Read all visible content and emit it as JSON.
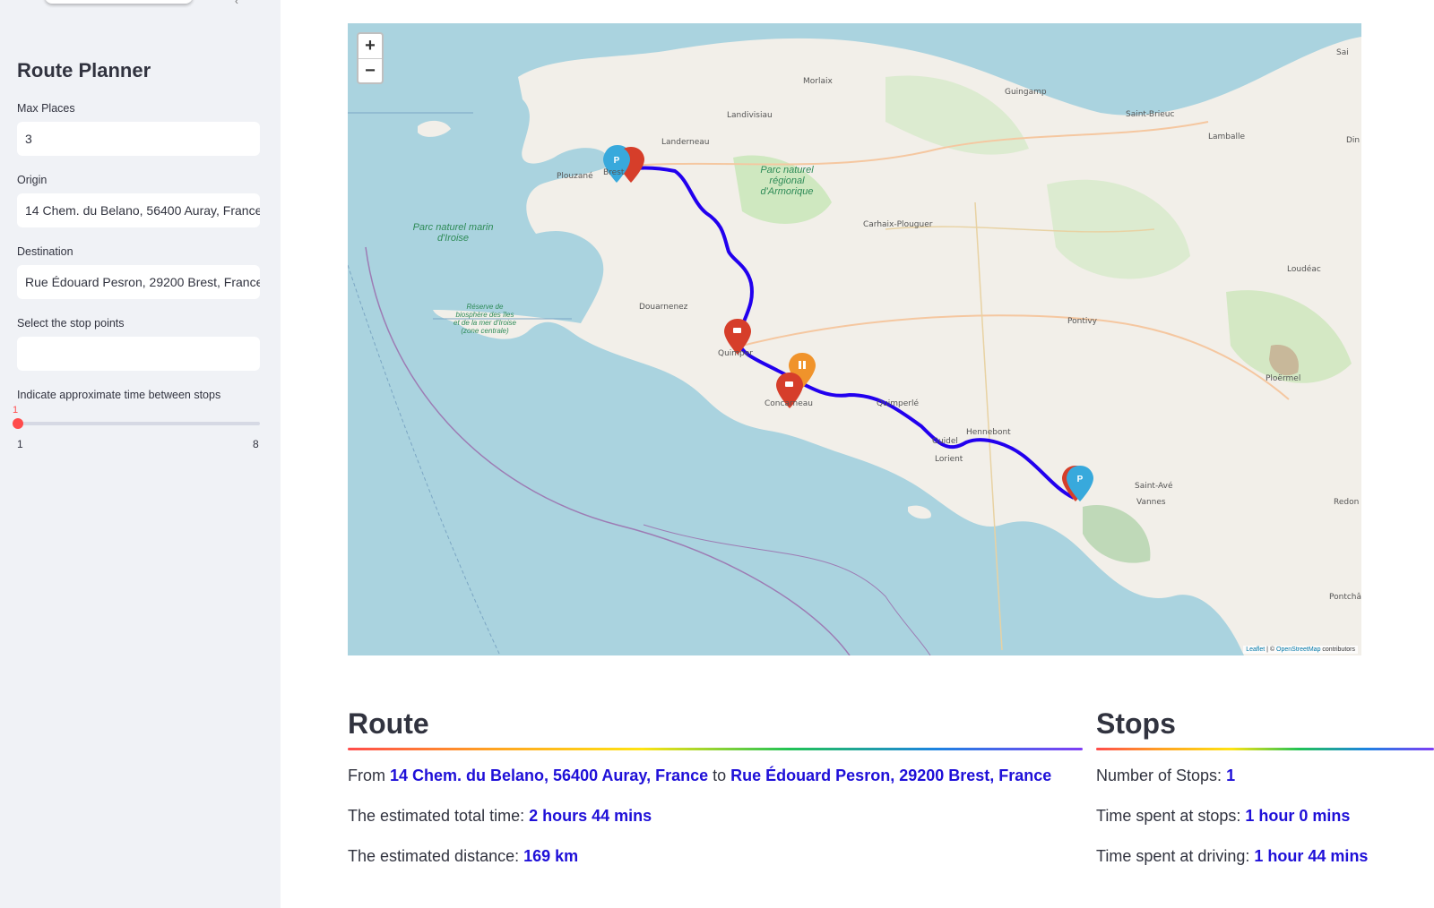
{
  "sidebar": {
    "title": "Route Planner",
    "max_places_label": "Max Places",
    "max_places_value": "3",
    "origin_label": "Origin",
    "origin_value": "14 Chem. du Belano, 56400 Auray, France",
    "destination_label": "Destination",
    "destination_value": "Rue Édouard Pesron, 29200 Brest, France",
    "stop_points_label": "Select the stop points",
    "stop_points_value": "",
    "time_label": "Indicate approximate time between stops",
    "time_value": "1",
    "time_min": "1",
    "time_max": "8",
    "time_level_fraction": 0
  },
  "map": {
    "zoom_in": "+",
    "zoom_out": "−",
    "attribution_leaflet": "Leaflet",
    "attribution_sep": " | © ",
    "attribution_osm": "OpenStreetMap",
    "attribution_suffix": " contributors",
    "route_color": "#2200ee",
    "places": {
      "morlaix": "Morlaix",
      "guingamp": "Guingamp",
      "saint_brieuc": "Saint-Brieuc",
      "lamballe": "Lamballe",
      "landivisiau": "Landivisiau",
      "landerneau": "Landerneau",
      "plouzane": "Plouzané",
      "brest": "Brest",
      "carhaix": "Carhaix-Plouguer",
      "loudeac": "Loudéac",
      "douarnenez": "Douarnenez",
      "pontivy": "Pontivy",
      "quimper": "Quimper",
      "concarneau": "Concarneau",
      "quimperle": "Quimperlé",
      "ploermel": "Ploërmel",
      "hennebont": "Hennebont",
      "guidel": "Guidel",
      "lorient": "Lorient",
      "saint_ave": "Saint-Avé",
      "vannes": "Vannes",
      "redon": "Redon",
      "pontchateau": "Pontchâteau",
      "din": "Din",
      "sai": "Sai"
    },
    "parks": {
      "armorique": "Parc naturel régional d'Armorique",
      "iroise": "Parc naturel marin d'Iroise",
      "reserve": "Réserve de biosphère des îles et de la mer d'Iroise (zone centrale)"
    }
  },
  "route": {
    "heading": "Route",
    "from_prefix": "From ",
    "origin": "14 Chem. du Belano, 56400 Auray, France",
    "to_word": " to ",
    "destination": "Rue Édouard Pesron, 29200 Brest, France",
    "time_prefix": "The estimated total time: ",
    "total_time": "2 hours 44 mins",
    "distance_prefix": "The estimated distance: ",
    "distance": "169 km"
  },
  "stops": {
    "heading": "Stops",
    "count_prefix": "Number of Stops: ",
    "count": "1",
    "stop_time_prefix": "Time spent at stops: ",
    "stop_time": "1 hour 0 mins",
    "drive_time_prefix": "Time spent at driving: ",
    "drive_time": "1 hour 44 mins"
  },
  "colors": {
    "accent": "#ff4b4b",
    "highlight": "#1f10d8",
    "marker_blue": "#38a9dc",
    "marker_red": "#d63e2a",
    "marker_orange": "#f0932b"
  }
}
